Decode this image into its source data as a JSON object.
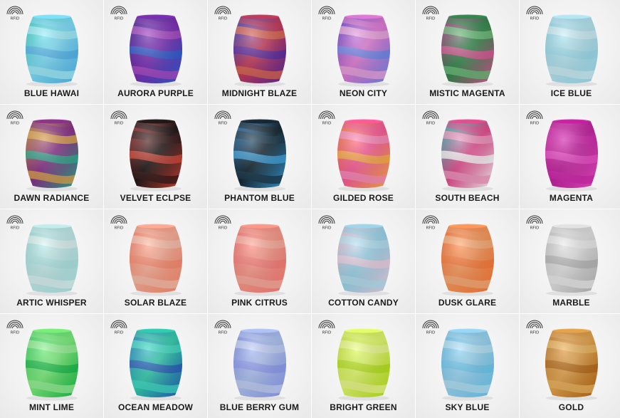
{
  "rfid_text": "RFID",
  "items": [
    {
      "label": "BLUE HAWAI",
      "colors": [
        "#2fd6c4",
        "#7fe3ff",
        "#55b8f0",
        "#a6f3ff"
      ]
    },
    {
      "label": "AURORA PURPLE",
      "colors": [
        "#3a1f96",
        "#7d2bb8",
        "#2f63d6",
        "#b04cc9"
      ]
    },
    {
      "label": "MIDNIGHT BLAZE",
      "colors": [
        "#2a3cc0",
        "#c8385a",
        "#5a2ea8",
        "#e06a50"
      ]
    },
    {
      "label": "NEON CITY",
      "colors": [
        "#5b3ad0",
        "#e57ad8",
        "#6f8cf0",
        "#f0a8e0"
      ]
    },
    {
      "label": "MISTIC MAGENTA",
      "colors": [
        "#b8308a",
        "#2f8a4a",
        "#e05a9a",
        "#6cc27a"
      ]
    },
    {
      "label": "ICE BLUE",
      "colors": [
        "#8fd8ee",
        "#b7e9f6",
        "#9fe0f1",
        "#d2f3fa"
      ]
    },
    {
      "label": "DAWN RADIANCE",
      "colors": [
        "#c98a2e",
        "#8a2f8a",
        "#2fb08f",
        "#e3a84a"
      ]
    },
    {
      "label": "VELVET ECLPSE",
      "colors": [
        "#b02a2a",
        "#1c1414",
        "#d4483a",
        "#3a1a1a"
      ]
    },
    {
      "label": "PHANTOM BLUE",
      "colors": [
        "#1e6fb8",
        "#12242e",
        "#3fa4e0",
        "#1b3a4e"
      ]
    },
    {
      "label": "GILDED ROSE",
      "colors": [
        "#ff7a30",
        "#ff5a9a",
        "#ffb347",
        "#ff8fc0"
      ]
    },
    {
      "label": "SOUTH BEACH",
      "colors": [
        "#1ec2b4",
        "#e84a8f",
        "#ffffff",
        "#f59ac0"
      ]
    },
    {
      "label": "MAGENTA",
      "colors": [
        "#e52ab6",
        "#c61fa2",
        "#f04fca",
        "#d628b0"
      ]
    },
    {
      "label": "ARTIC WHISPER",
      "colors": [
        "#9ae3e0",
        "#c5f0ef",
        "#afe9e7",
        "#e2f8f7"
      ]
    },
    {
      "label": "SOLAR BLAZE",
      "colors": [
        "#ff7a5e",
        "#ffae96",
        "#ff8c70",
        "#ffc2ae"
      ]
    },
    {
      "label": "PINK CITRUS",
      "colors": [
        "#ff6b6b",
        "#ff9a8a",
        "#ff7f7a",
        "#ffb0a0"
      ]
    },
    {
      "label": "COTTON CANDY",
      "colors": [
        "#f7c0d8",
        "#9ad8ee",
        "#f3d3e6",
        "#b6e4f4"
      ]
    },
    {
      "label": "DUSK GLARE",
      "colors": [
        "#ff6a2a",
        "#ff9a5a",
        "#ff7b3a",
        "#ffb07a"
      ]
    },
    {
      "label": "MARBLE",
      "colors": [
        "#c8c8c8",
        "#e6e6e6",
        "#b8b8b8",
        "#f0f0f0"
      ]
    },
    {
      "label": "MINT LIME",
      "colors": [
        "#2ad85a",
        "#7af27a",
        "#19c04a",
        "#9af59a"
      ]
    },
    {
      "label": "OCEAN MEADOW",
      "colors": [
        "#1f7fd0",
        "#2fd0b0",
        "#2a5fc0",
        "#3fe0c8"
      ]
    },
    {
      "label": "BLUE BERRY GUM",
      "colors": [
        "#7b8cf0",
        "#b0c6f7",
        "#8f9ef4",
        "#c7d4fa"
      ]
    },
    {
      "label": "BRIGHT GREEN",
      "colors": [
        "#c9f02a",
        "#e6ff6a",
        "#b8e61a",
        "#f0ff90"
      ]
    },
    {
      "label": "SKY BLUE",
      "colors": [
        "#5ec2f0",
        "#9ad9f7",
        "#6fcbf3",
        "#b7e6fa"
      ]
    },
    {
      "label": "GOLD",
      "colors": [
        "#c9781e",
        "#e8a54a",
        "#b86a18",
        "#f0b860"
      ]
    }
  ]
}
